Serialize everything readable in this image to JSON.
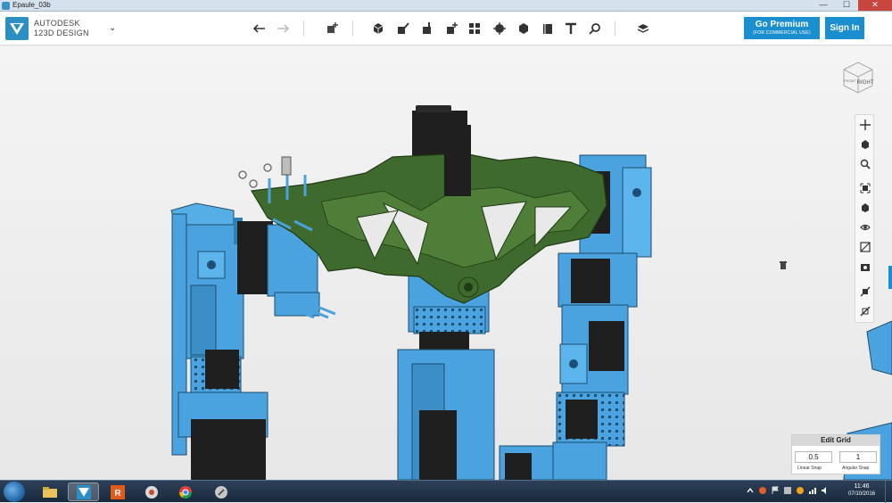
{
  "window": {
    "title": "Epaule_03b",
    "controls": {
      "minimize": "—",
      "maximize": "☐",
      "close": "✕"
    }
  },
  "brand": {
    "line1": "AUTODESK",
    "line2": "123D DESIGN",
    "menu_icon": "chevron-down-icon"
  },
  "toolbar": {
    "undo_icon": "undo-icon",
    "redo_icon": "redo-icon",
    "tools": [
      "transform-icon",
      "primitives-icon",
      "sketch-icon",
      "construct-icon",
      "modify-icon",
      "pattern-icon",
      "group-icon",
      "combine-icon",
      "measure-icon",
      "text-icon",
      "snap-icon",
      "material-icon"
    ]
  },
  "header": {
    "premium_label": "Go Premium",
    "premium_sub": "(FOR COMMERCIAL USE)",
    "signin_label": "Sign In"
  },
  "viewcube": {
    "face_label": "RIGHT",
    "side_label": "FRONT"
  },
  "navbar": {
    "items": [
      "pan-icon",
      "orbit-icon",
      "zoom-icon",
      "fit-icon",
      "views-icon",
      "visibility-icon",
      "hide-icon",
      "camera-icon",
      "material-hide-icon",
      "outline-hide-icon"
    ]
  },
  "grid_panel": {
    "title": "Edit Grid",
    "snap_value": "0.5",
    "grid_value": "1",
    "snap_label": "Linear Snap",
    "grid_label": "Angular Snap"
  },
  "taskbar": {
    "apps": [
      "explorer-icon",
      "123d-design-icon",
      "revo-uninstaller-icon",
      "settings-app-icon",
      "chrome-icon",
      "media-icon"
    ],
    "time": "11:46",
    "date": "07/10/2016"
  },
  "colors": {
    "accent": "#1a8ecf",
    "part_blue": "#4aa3df",
    "part_green": "#3f6a2d",
    "servo_black": "#1f1f1f"
  }
}
